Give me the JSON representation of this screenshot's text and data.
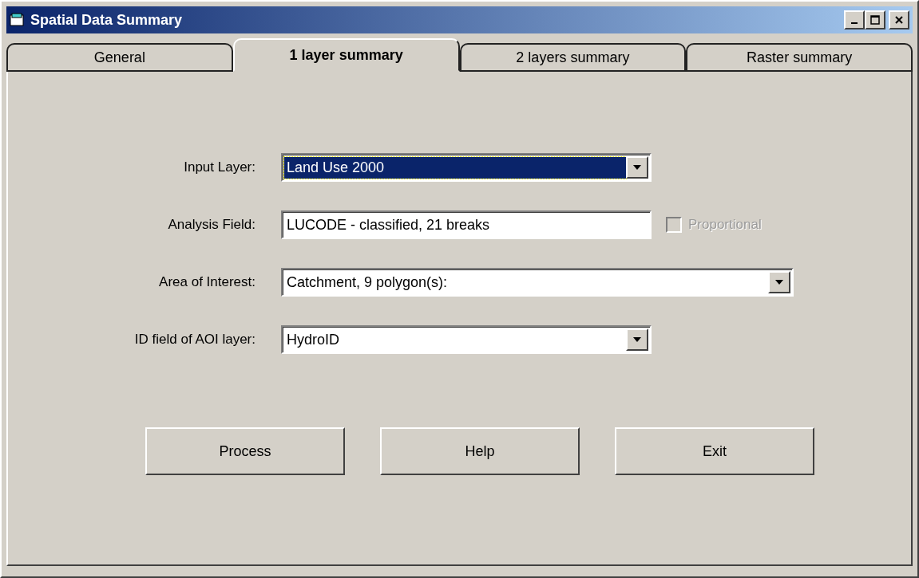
{
  "window": {
    "title": "Spatial Data Summary"
  },
  "tabs": [
    {
      "label": "General",
      "selected": false
    },
    {
      "label": "1 layer summary",
      "selected": true
    },
    {
      "label": "2 layers summary",
      "selected": false
    },
    {
      "label": "Raster summary",
      "selected": false
    }
  ],
  "fields": [
    {
      "label": "Input Layer:",
      "kind": "dropdown",
      "value": "Land Use 2000",
      "focused": true,
      "wide": false
    },
    {
      "label": "Analysis Field:",
      "kind": "text",
      "value": "LUCODE - classified, 21 breaks",
      "focused": false,
      "wide": false,
      "checkbox": {
        "label": "Proportional",
        "checked": false,
        "disabled": true
      }
    },
    {
      "label": "Area of Interest:",
      "kind": "dropdown",
      "value": "Catchment, 9 polygon(s):",
      "focused": false,
      "wide": true
    },
    {
      "label": "ID field of AOI layer:",
      "kind": "dropdown",
      "value": "HydroID",
      "focused": false,
      "wide": false
    }
  ],
  "buttons": [
    "Process",
    "Help",
    "Exit"
  ]
}
